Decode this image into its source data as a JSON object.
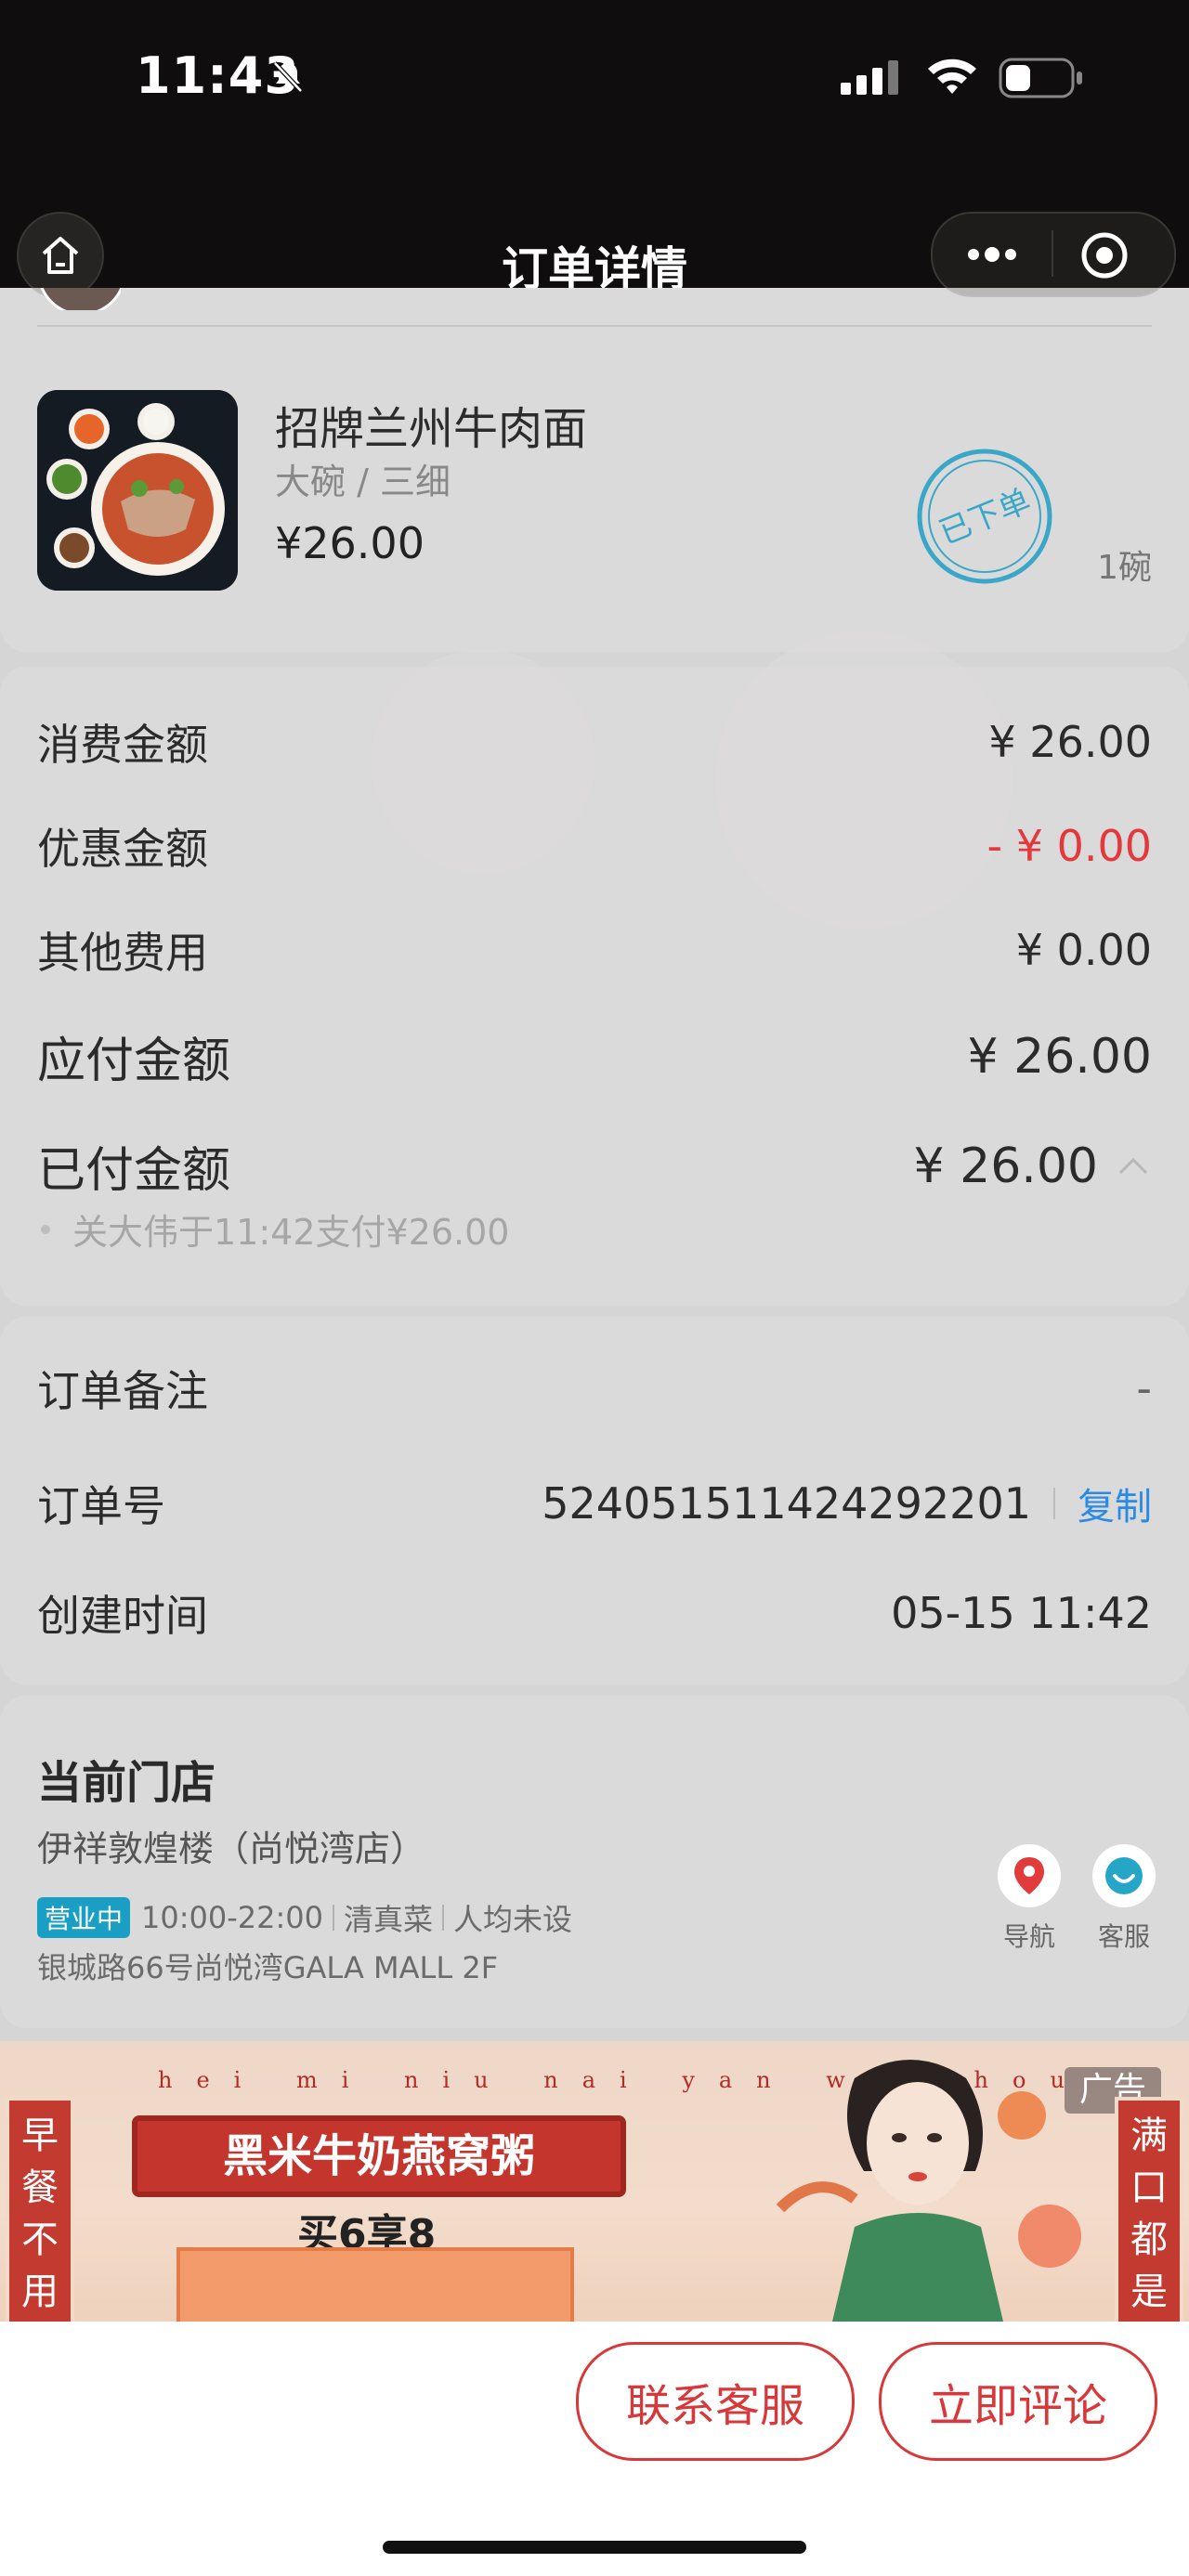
{
  "status_bar": {
    "time": "11:43"
  },
  "nav": {
    "title": "订单详情"
  },
  "dish": {
    "name": "招牌兰州牛肉面",
    "spec": "大碗 / 三细",
    "price": "¥26.00",
    "quantity": "1碗",
    "stamp": "已下单"
  },
  "amounts": {
    "consume": {
      "label": "消费金额",
      "value": "¥ 26.00"
    },
    "discount": {
      "label": "优惠金额",
      "value": "- ¥ 0.00"
    },
    "other": {
      "label": "其他费用",
      "value": "¥ 0.00"
    },
    "payable": {
      "label": "应付金额",
      "value": "¥ 26.00"
    },
    "paid": {
      "label": "已付金额",
      "value": "¥ 26.00"
    },
    "paid_note": "关大伟于11:42支付¥26.00"
  },
  "order": {
    "remark_label": "订单备注",
    "remark_value": "-",
    "number_label": "订单号",
    "number_value": "524051511424292201",
    "copy_label": "复制",
    "created_label": "创建时间",
    "created_value": "05-15 11:42"
  },
  "store": {
    "section_title": "当前门店",
    "name": "伊祥敦煌楼（尚悦湾店）",
    "status_badge": "营业中",
    "hours": "10:00-22:00",
    "category": "清真菜",
    "avg_price": "人均未设",
    "address": "银城路66号尚悦湾GALA MALL 2F",
    "nav_label": "导航",
    "service_label": "客服"
  },
  "ad": {
    "tag": "广告",
    "pinyin": "hei mi niu nai yan wo zhou",
    "title": "黑米牛奶燕窝粥",
    "subtitle": "买6享8",
    "left_text": "早餐不用",
    "right_text": "满口都是"
  },
  "actions": {
    "contact": "联系客服",
    "review": "立即评论"
  },
  "colors": {
    "discount": "#e4393c",
    "link": "#2b8ae3",
    "button_red": "#d8383a",
    "badge": "#1a9fc4"
  }
}
